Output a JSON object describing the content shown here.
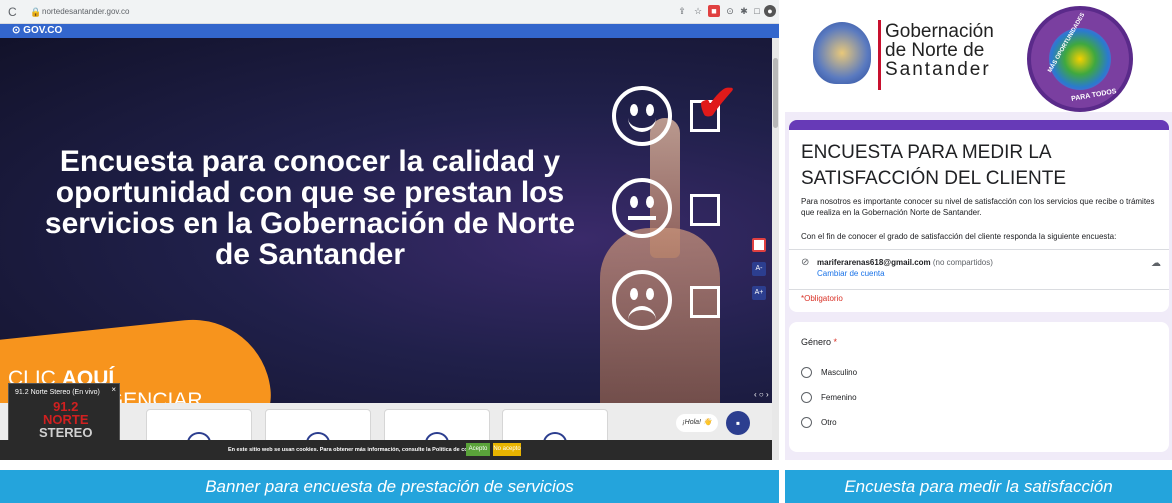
{
  "browser": {
    "url": "nortedesantander.gov.co",
    "gov_label": "GOV.CO"
  },
  "banner": {
    "title": "Encuesta para conocer la calidad y oportunidad con que se prestan los servicios en la Gobernación de Norte de Santander",
    "cta_line1_prefix": "CLIC ",
    "cta_line1_bold": "AQUÍ",
    "cta_line2": "PARA DILIGENCIAR",
    "accessibility": [
      "A-",
      "A+"
    ],
    "colors": {
      "cta": "#f7941d",
      "check": "#e01a1a",
      "gov_bar": "#3366cc"
    }
  },
  "radio_widget": {
    "title": "91.2 Norte Stereo (En vivo)",
    "logo_top": "91.2",
    "logo_mid": "NORTE",
    "logo_bottom": "STEREO"
  },
  "cookie_bar": {
    "text": "En este sitio web se usan cookies. Para obtener más información, consulte la Política de cookies.",
    "accept": "Acepto",
    "reject": "No acepto"
  },
  "chat": {
    "greeting": "¡Hola! 👋"
  },
  "form": {
    "logo_text": [
      "Gobernación",
      "de Norte de",
      "Santander"
    ],
    "logo_circle_top": "MÁS OPORTUNIDADES",
    "logo_circle_bottom": "PARA TODOS",
    "title": "ENCUESTA PARA MEDIR LA SATISFACCIÓN DEL CLIENTE",
    "description": "Para nosotros es importante conocer su nivel de satisfacción con los servicios que recibe o trámites que realiza en la Gobernación Norte de Santander.",
    "description2": "Con el fin de conocer el grado de satisfacción del cliente responda la siguiente encuesta:",
    "email": "mariferarenas618@gmail.com",
    "not_shared": "(no compartidos)",
    "switch_account": "Cambiar de cuenta",
    "required_note": "*Obligatorio",
    "question": {
      "label": "Género",
      "required_mark": "*",
      "options": [
        "Masculino",
        "Femenino",
        "Otro"
      ]
    },
    "accent_color": "#673ab7"
  },
  "captions": {
    "left": "Banner para encuesta de prestación de servicios",
    "right": "Encuesta para medir la satisfacción"
  }
}
